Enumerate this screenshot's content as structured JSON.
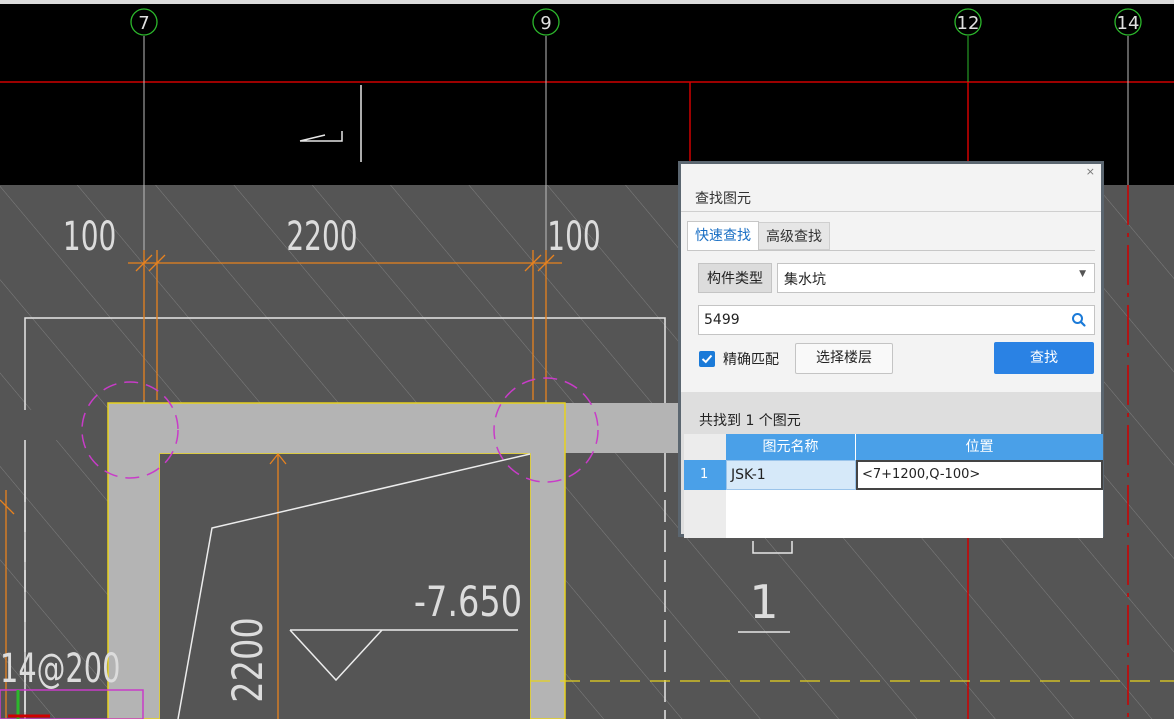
{
  "drawing": {
    "axis_labels": [
      "7",
      "9",
      "12",
      "14"
    ],
    "dim_left": "100",
    "dim_mid": "2200",
    "dim_right": "100",
    "elevation": "-7.650",
    "dim_vertical": "2200",
    "rebar_label": "14@200",
    "section_mark": "1",
    "colors": {
      "background_top": "#000000",
      "slab": "#555555",
      "axis_red": "#d00000",
      "dim_orange": "#e8821e",
      "outline_yellow": "#e6d21e",
      "circle_magenta": "#c83cc8"
    }
  },
  "dialog": {
    "close_label": "×",
    "title": "查找图元",
    "tabs": [
      {
        "label": "快速查找"
      },
      {
        "label": "高级查找"
      }
    ],
    "type_label": "构件类型",
    "type_value": "集水坑",
    "search_value": "5499",
    "checkbox_label": "精确匹配",
    "checkbox_checked": true,
    "floor_button": "选择楼层",
    "find_button": "查找",
    "result_summary": "共找到 1 个图元",
    "table": {
      "headers": [
        "图元名称",
        "位置"
      ],
      "rows": [
        {
          "num": "1",
          "name": "JSK-1",
          "position": "<7+1200,Q-100>"
        }
      ]
    },
    "accent_color": "#2a82e4"
  }
}
